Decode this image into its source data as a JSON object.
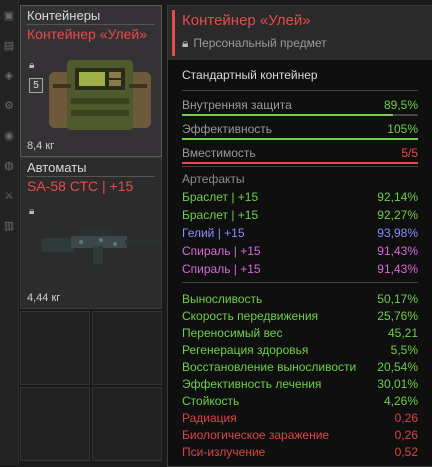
{
  "strip_icons": [
    "▣",
    "▤",
    "◈",
    "⚙",
    "◉",
    "◍",
    "⚔",
    "▥"
  ],
  "inventory": [
    {
      "category": "Контейнеры",
      "name": "Контейнер «Улей»",
      "weight": "8,4 кг",
      "tier": "5",
      "selected": true
    },
    {
      "category": "Автоматы",
      "name": "SA-58 СТС | +15",
      "weight": "4,44 кг",
      "tier": "",
      "selected": false
    }
  ],
  "tooltip": {
    "title": "Контейнер «Улей»",
    "subtitle": "Персональный предмет",
    "type": "Стандартный контейнер",
    "stats": [
      {
        "label": "Внутренняя защита",
        "value": "89,5%",
        "fill": 0.895,
        "color": "#6fcf4a"
      },
      {
        "label": "Эффективность",
        "value": "105%",
        "fill": 1.0,
        "color": "#6fcf4a"
      },
      {
        "label": "Вместимость",
        "value": "5/5",
        "fill": 1.0,
        "color": "#e84a4a"
      }
    ],
    "artifacts_label": "Артефакты",
    "artifacts": [
      {
        "label": "Браслет | +15",
        "value": "92,14%",
        "color": "#6fcf4a"
      },
      {
        "label": "Браслет | +15",
        "value": "92,27%",
        "color": "#6fcf4a"
      },
      {
        "label": "Гелий | +15",
        "value": "93,98%",
        "color": "#8c8cff"
      },
      {
        "label": "Спираль | +15",
        "value": "91,43%",
        "color": "#d66bd6"
      },
      {
        "label": "Спираль | +15",
        "value": "91,43%",
        "color": "#d66bd6"
      }
    ],
    "effects": [
      {
        "label": "Выносливость",
        "value": "50,17%",
        "color": "#6fcf4a"
      },
      {
        "label": "Скорость передвижения",
        "value": "25,76%",
        "color": "#6fcf4a"
      },
      {
        "label": "Переносимый вес",
        "value": "45,21",
        "color": "#6fcf4a"
      },
      {
        "label": "Регенерация здоровья",
        "value": "5,5%",
        "color": "#6fcf4a"
      },
      {
        "label": "Восстановление выносливости",
        "value": "20,54%",
        "color": "#6fcf4a"
      },
      {
        "label": "Эффективность лечения",
        "value": "30,01%",
        "color": "#6fcf4a"
      },
      {
        "label": "Стойкость",
        "value": "4,26%",
        "color": "#6fcf4a"
      },
      {
        "label": "Радиация",
        "value": "0,26",
        "color": "#d94545"
      },
      {
        "label": "Биологическое заражение",
        "value": "0,26",
        "color": "#d94545"
      },
      {
        "label": "Пси-излучение",
        "value": "0,52",
        "color": "#d94545"
      }
    ]
  }
}
